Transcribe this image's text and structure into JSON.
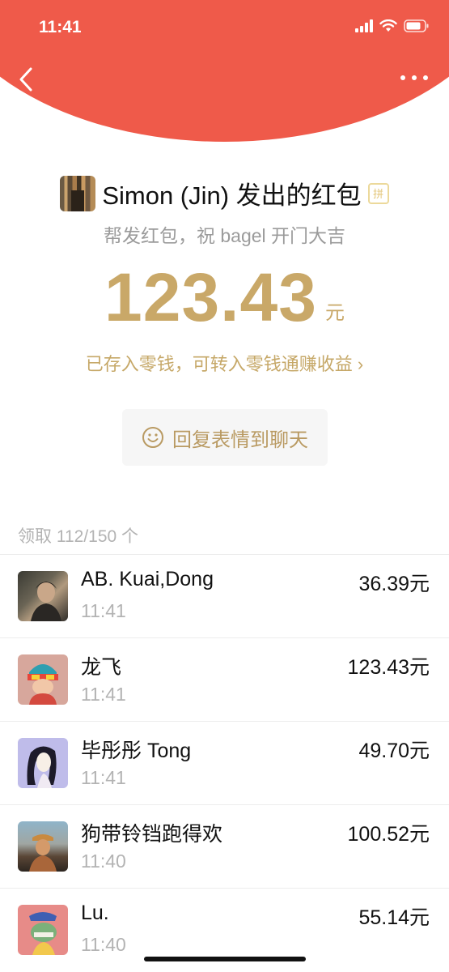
{
  "status_bar": {
    "time": "11:41"
  },
  "colors": {
    "header_red": "#ef5a4a",
    "gold": "#c9a868",
    "muted_gray": "#b3b3b3"
  },
  "header": {
    "back_icon": "chevron-left-icon",
    "more_icon": "more-dots-icon"
  },
  "sender": {
    "name": "Simon (Jin) 发出的红包",
    "badge": "拼",
    "greeting": "帮发红包，祝 bagel 开门大吉"
  },
  "amount": {
    "value": "123.43",
    "unit": "元"
  },
  "balance_link": "已存入零钱，可转入零钱通赚收益 ›",
  "reply_button": {
    "label": "回复表情到聊天",
    "icon": "smile-icon"
  },
  "claimed": {
    "summary": "领取 112/150 个",
    "items": [
      {
        "name": "AB. Kuai,Dong",
        "time": "11:41",
        "amount": "36.39元"
      },
      {
        "name": "龙飞",
        "time": "11:41",
        "amount": "123.43元"
      },
      {
        "name": "毕彤彤 Tong",
        "time": "11:41",
        "amount": "49.70元"
      },
      {
        "name": "狗带铃铛跑得欢",
        "time": "11:40",
        "amount": "100.52元"
      },
      {
        "name": "Lu.",
        "time": "11:40",
        "amount": "55.14元"
      }
    ]
  }
}
